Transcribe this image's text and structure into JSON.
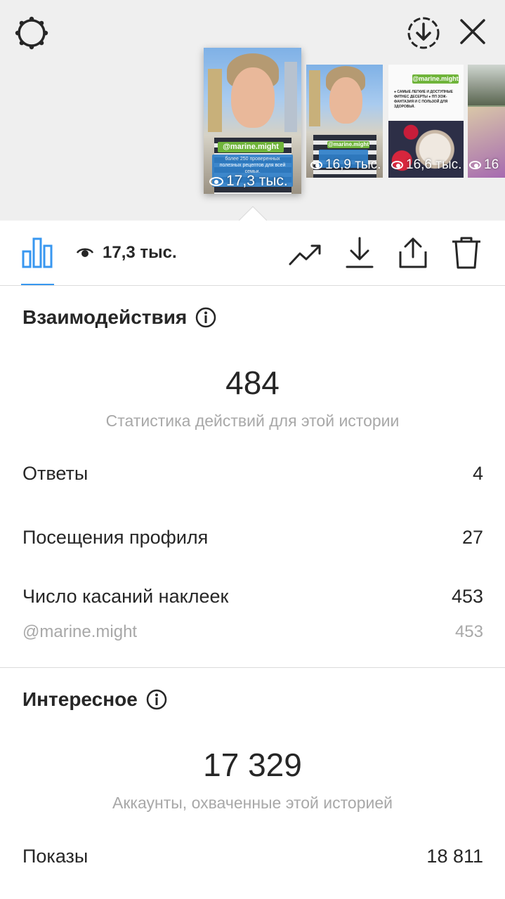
{
  "header": {
    "icons": [
      "settings-gear-icon",
      "download-circle-icon",
      "close-icon"
    ]
  },
  "stories": [
    {
      "sticker": "@marine.might",
      "views": "17,3 тыс.",
      "caption": "более 250 проверенных полезных рецептов для всей семьи."
    },
    {
      "sticker": "@marine.might",
      "views": "16,9 тыс."
    },
    {
      "sticker": "@marine.might",
      "views": "16,6 тыс.",
      "text": "● САМЫЕ ЛЁГКИЕ И ДОСТУПНЫЕ ФИТНЕС ДЕСЕРТЫ ● ПП ЗОЖ-ФАНТАЗИЯ И С ПОЛЬЗОЙ ДЛЯ ЗДОРОВЬЯ."
    },
    {
      "views": "16"
    }
  ],
  "toolbar": {
    "views": "17,3 тыс.",
    "icons": [
      "insights-bar-chart-icon",
      "eye-icon",
      "trend-arrow-icon",
      "download-icon",
      "share-icon",
      "delete-trash-icon"
    ],
    "accent": "#3897f0"
  },
  "interactions": {
    "title": "Взаимодействия",
    "total": "484",
    "subtitle": "Статистика действий для этой истории",
    "rows": [
      {
        "label": "Ответы",
        "value": "4"
      },
      {
        "label": "Посещения профиля",
        "value": "27"
      },
      {
        "label": "Число касаний наклеек",
        "value": "453"
      }
    ],
    "sub_row": {
      "label": "@marine.might",
      "value": "453"
    }
  },
  "discovery": {
    "title": "Интересное",
    "total": "17 329",
    "subtitle": "Аккаунты, охваченные этой историей",
    "rows": [
      {
        "label": "Показы",
        "value": "18 811"
      }
    ]
  }
}
